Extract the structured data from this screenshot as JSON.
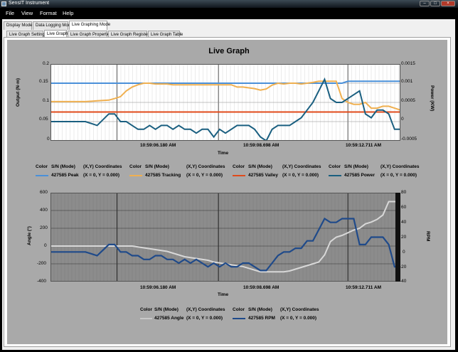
{
  "window": {
    "title": "SensIT Instrument"
  },
  "menu": [
    "File",
    "View",
    "Format",
    "Help"
  ],
  "mode_tabs": [
    "Display Mode",
    "Data Logging Mode",
    "Live Graphing Mode"
  ],
  "sub_tabs": [
    "Live Graph Settings",
    "Live Graph",
    "Live Graph Properties",
    "Live Graph Registers",
    "Live Graph Table"
  ],
  "top_chart": {
    "title": "Live Graph",
    "ylabel_left": "Output (N·m)",
    "ylabel_right": "Power (KW)",
    "xlabel": "Time",
    "y_ticks": [
      "0.2",
      "0.15",
      "0.1",
      "0.05",
      "0"
    ],
    "y2_ticks": [
      "0.0015",
      "0.001",
      "0.0005",
      "0",
      "-0.0005"
    ],
    "x_ticks": [
      "10:59:06.180 AM",
      "10:59:08.698 AM",
      "10:59:12.711 AM"
    ]
  },
  "bottom_chart": {
    "ylabel_left": "Angle (°)",
    "ylabel_right": "RPM",
    "xlabel": "Time",
    "y_ticks": [
      "600",
      "400",
      "200",
      "0",
      "-200",
      "-400"
    ],
    "y2_ticks": [
      "80",
      "60",
      "40",
      "20",
      "0",
      "-20",
      "-40"
    ],
    "x_ticks": [
      "10:59:06.180 AM",
      "10:59:08.698 AM",
      "10:59:12.711 AM"
    ]
  },
  "legend_headers": {
    "color": "Color",
    "sn": "S/N (Mode)",
    "xy": "(X,Y) Coordinates"
  },
  "top_legend": [
    {
      "sn": "427585 Peak",
      "xy": "(X = 0, Y = 0.000)",
      "color": "#4a90d9"
    },
    {
      "sn": "427585 Tracking",
      "xy": "(X = 0, Y = 0.000)",
      "color": "#f0b050"
    },
    {
      "sn": "427585 Valley",
      "xy": "(X = 0, Y = 0.000)",
      "color": "#e04a1a"
    },
    {
      "sn": "427585 Power",
      "xy": "(X = 0, Y = 0.000)",
      "color": "#1a5f80"
    }
  ],
  "bottom_legend": [
    {
      "sn": "427585 Angle",
      "xy": "(X = 0, Y = 0.000)",
      "color": "#d8d8d8"
    },
    {
      "sn": "427585 RPM",
      "xy": "(X = 0, Y = 0.000)",
      "color": "#1f4a8a"
    }
  ],
  "chart_data": [
    {
      "type": "line",
      "title": "Live Graph",
      "xlabel": "Time",
      "ylabel": "Output (N·m)",
      "y2label": "Power (KW)",
      "ylim": [
        0,
        0.2
      ],
      "y2lim": [
        -0.0005,
        0.0015
      ],
      "x": [
        0,
        2,
        4,
        6,
        8,
        10,
        11,
        12,
        13,
        14,
        15,
        16,
        17,
        18,
        19,
        20,
        21,
        22,
        23,
        24,
        25,
        26,
        27,
        28,
        29,
        30,
        31,
        32,
        33,
        34,
        35,
        36,
        37,
        38,
        39,
        40,
        41,
        42,
        43,
        44,
        45,
        46,
        47,
        48,
        49,
        50,
        51,
        52,
        53,
        54,
        55,
        56,
        57,
        58,
        59,
        60
      ],
      "series": [
        {
          "name": "427585 Peak",
          "axis": "left",
          "values": [
            0.15,
            0.15,
            0.15,
            0.15,
            0.15,
            0.15,
            0.15,
            0.15,
            0.15,
            0.15,
            0.15,
            0.15,
            0.15,
            0.15,
            0.15,
            0.15,
            0.15,
            0.15,
            0.15,
            0.15,
            0.15,
            0.15,
            0.15,
            0.15,
            0.15,
            0.15,
            0.15,
            0.15,
            0.15,
            0.15,
            0.15,
            0.15,
            0.15,
            0.15,
            0.15,
            0.15,
            0.15,
            0.15,
            0.15,
            0.15,
            0.15,
            0.15,
            0.15,
            0.15,
            0.15,
            0.15,
            0.155,
            0.155,
            0.155,
            0.155,
            0.155,
            0.155,
            0.155,
            0.155,
            0.155,
            0.155
          ]
        },
        {
          "name": "427585 Tracking",
          "axis": "left",
          "values": [
            0.102,
            0.102,
            0.102,
            0.102,
            0.104,
            0.106,
            0.11,
            0.115,
            0.13,
            0.14,
            0.146,
            0.15,
            0.15,
            0.148,
            0.148,
            0.148,
            0.146,
            0.146,
            0.146,
            0.146,
            0.146,
            0.146,
            0.146,
            0.146,
            0.146,
            0.146,
            0.146,
            0.14,
            0.14,
            0.138,
            0.136,
            0.132,
            0.135,
            0.145,
            0.15,
            0.148,
            0.15,
            0.15,
            0.148,
            0.15,
            0.152,
            0.155,
            0.155,
            0.155,
            0.155,
            0.11,
            0.1,
            0.095,
            0.095,
            0.1,
            0.085,
            0.085,
            0.09,
            0.09,
            0.085,
            0.08
          ]
        },
        {
          "name": "427585 Valley",
          "axis": "left",
          "values": [
            0.075,
            0.075,
            0.075,
            0.075,
            0.075,
            0.075,
            0.075,
            0.075,
            0.075,
            0.075,
            0.075,
            0.075,
            0.075,
            0.075,
            0.075,
            0.075,
            0.075,
            0.075,
            0.075,
            0.075,
            0.075,
            0.075,
            0.075,
            0.075,
            0.075,
            0.075,
            0.075,
            0.075,
            0.075,
            0.075,
            0.075,
            0.075,
            0.075,
            0.075,
            0.075,
            0.075,
            0.075,
            0.075,
            0.075,
            0.075,
            0.075,
            0.075,
            0.075,
            0.075,
            0.075,
            0.075,
            0.075,
            0.075,
            0.075,
            0.075,
            0.075,
            0.075,
            0.075,
            0.075,
            0.075,
            0.075
          ]
        },
        {
          "name": "427585 Power",
          "axis": "right",
          "values": [
            0.0,
            0.0,
            0.0,
            0.0,
            -0.0001,
            0.0002,
            0.0002,
            0.0,
            0.0,
            -0.0001,
            -0.0002,
            -0.0002,
            -0.0001,
            -0.0002,
            -0.0001,
            -0.0001,
            -0.0002,
            -0.0001,
            -0.0002,
            -0.0002,
            -0.0003,
            -0.0002,
            -0.0002,
            -0.0004,
            -0.0002,
            -0.0003,
            -0.0002,
            -0.0001,
            -0.0001,
            -0.0001,
            -0.0002,
            -0.0004,
            -0.0005,
            -0.0002,
            -0.0001,
            -0.0001,
            -0.0001,
            0.0,
            0.0001,
            0.0003,
            0.0005,
            0.0008,
            0.0011,
            0.0006,
            0.0005,
            0.0005,
            0.0006,
            0.0007,
            0.0008,
            0.0002,
            0.0001,
            0.0003,
            0.0003,
            0.0002,
            -0.0002,
            -0.0002
          ]
        }
      ]
    },
    {
      "type": "line",
      "xlabel": "Time",
      "ylabel": "Angle (°)",
      "y2label": "RPM",
      "ylim": [
        -400,
        600
      ],
      "y2lim": [
        -40,
        80
      ],
      "x": [
        0,
        2,
        4,
        6,
        8,
        10,
        11,
        12,
        13,
        14,
        15,
        16,
        17,
        18,
        19,
        20,
        21,
        22,
        23,
        24,
        25,
        26,
        27,
        28,
        29,
        30,
        31,
        32,
        33,
        34,
        35,
        36,
        37,
        38,
        39,
        40,
        41,
        42,
        43,
        44,
        45,
        46,
        47,
        48,
        49,
        50,
        51,
        52,
        53,
        54,
        55,
        56,
        57,
        58,
        59,
        60
      ],
      "series": [
        {
          "name": "427585 Angle",
          "axis": "left",
          "values": [
            0,
            0,
            0,
            0,
            0,
            0,
            0,
            0,
            0,
            0,
            -10,
            -20,
            -30,
            -40,
            -50,
            -60,
            -80,
            -100,
            -120,
            -130,
            -140,
            -150,
            -160,
            -180,
            -190,
            -200,
            -210,
            -220,
            -230,
            -250,
            -270,
            -290,
            -290,
            -290,
            -290,
            -290,
            -280,
            -260,
            -240,
            -220,
            -200,
            -180,
            -100,
            50,
            100,
            120,
            150,
            180,
            200,
            250,
            270,
            300,
            350,
            500,
            500,
            500
          ]
        },
        {
          "name": "427585 RPM",
          "axis": "right",
          "values": [
            0,
            0,
            0,
            0,
            -5,
            10,
            10,
            0,
            0,
            -5,
            -5,
            -10,
            -10,
            -5,
            -5,
            -10,
            -10,
            -15,
            -10,
            -15,
            -10,
            -15,
            -20,
            -15,
            -20,
            -15,
            -20,
            -20,
            -15,
            -15,
            -20,
            -25,
            -25,
            -15,
            -5,
            0,
            0,
            5,
            5,
            15,
            15,
            30,
            45,
            40,
            40,
            45,
            45,
            45,
            10,
            10,
            20,
            20,
            20,
            10,
            -20,
            -20
          ]
        }
      ]
    }
  ]
}
